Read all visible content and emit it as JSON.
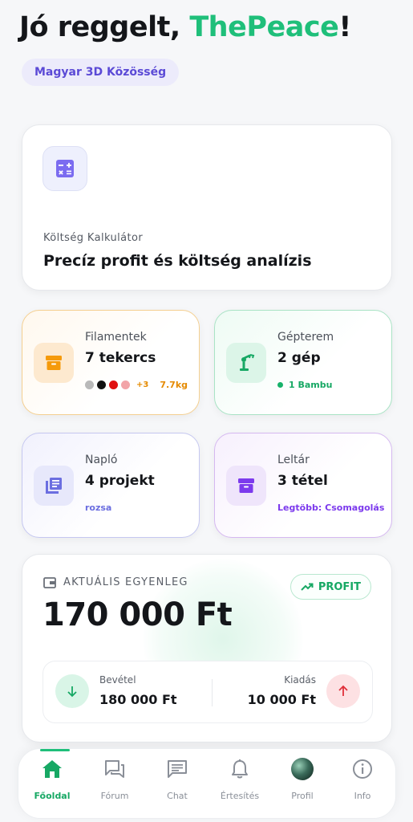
{
  "header": {
    "greeting_prefix": "Jó reggelt, ",
    "username": "ThePeace",
    "greeting_suffix": "!",
    "community_chip": "Magyar 3D Közösség"
  },
  "calculator_card": {
    "subtitle": "Költség Kalkulátor",
    "title": "Precíz profit és költség analízis",
    "icon": "calculator-icon"
  },
  "filaments_card": {
    "label": "Filamentek",
    "value": "7 tekercs",
    "swatch_colors": [
      "#b9b9b9",
      "#111111",
      "#e01010",
      "#f2a4a8"
    ],
    "extra_count": "+3",
    "weight": "7.7kg",
    "accent": "#f5a623",
    "icon": "archive-box-icon"
  },
  "machines_card": {
    "label": "Gépterem",
    "value": "2 gép",
    "status": "1 Bambu",
    "accent": "#17b26a",
    "icon": "robot-arm-icon"
  },
  "log_card": {
    "label": "Napló",
    "value": "4 projekt",
    "footer": "rozsa",
    "accent": "#6b6ee0",
    "icon": "notebook-icon"
  },
  "inventory_card": {
    "label": "Leltár",
    "value": "3 tétel",
    "footer": "Legtöbb: Csomagolás",
    "accent": "#7c3aed",
    "icon": "archive-box-icon"
  },
  "balance_card": {
    "heading": "AKTUÁLIS EGYENLEG",
    "amount": "170 000 Ft",
    "badge": "PROFIT",
    "income_label": "Bevétel",
    "income_value": "180 000 Ft",
    "expense_label": "Kiadás",
    "expense_value": "10 000 Ft"
  },
  "bottom_nav": {
    "items": [
      {
        "label": "Főoldal",
        "icon": "home-icon",
        "active": true
      },
      {
        "label": "Fórum",
        "icon": "forum-icon",
        "active": false
      },
      {
        "label": "Chat",
        "icon": "chat-icon",
        "active": false
      },
      {
        "label": "Értesítés",
        "icon": "bell-icon",
        "active": false
      },
      {
        "label": "Profil",
        "icon": "avatar",
        "active": false
      },
      {
        "label": "Info",
        "icon": "info-icon",
        "active": false
      }
    ]
  }
}
